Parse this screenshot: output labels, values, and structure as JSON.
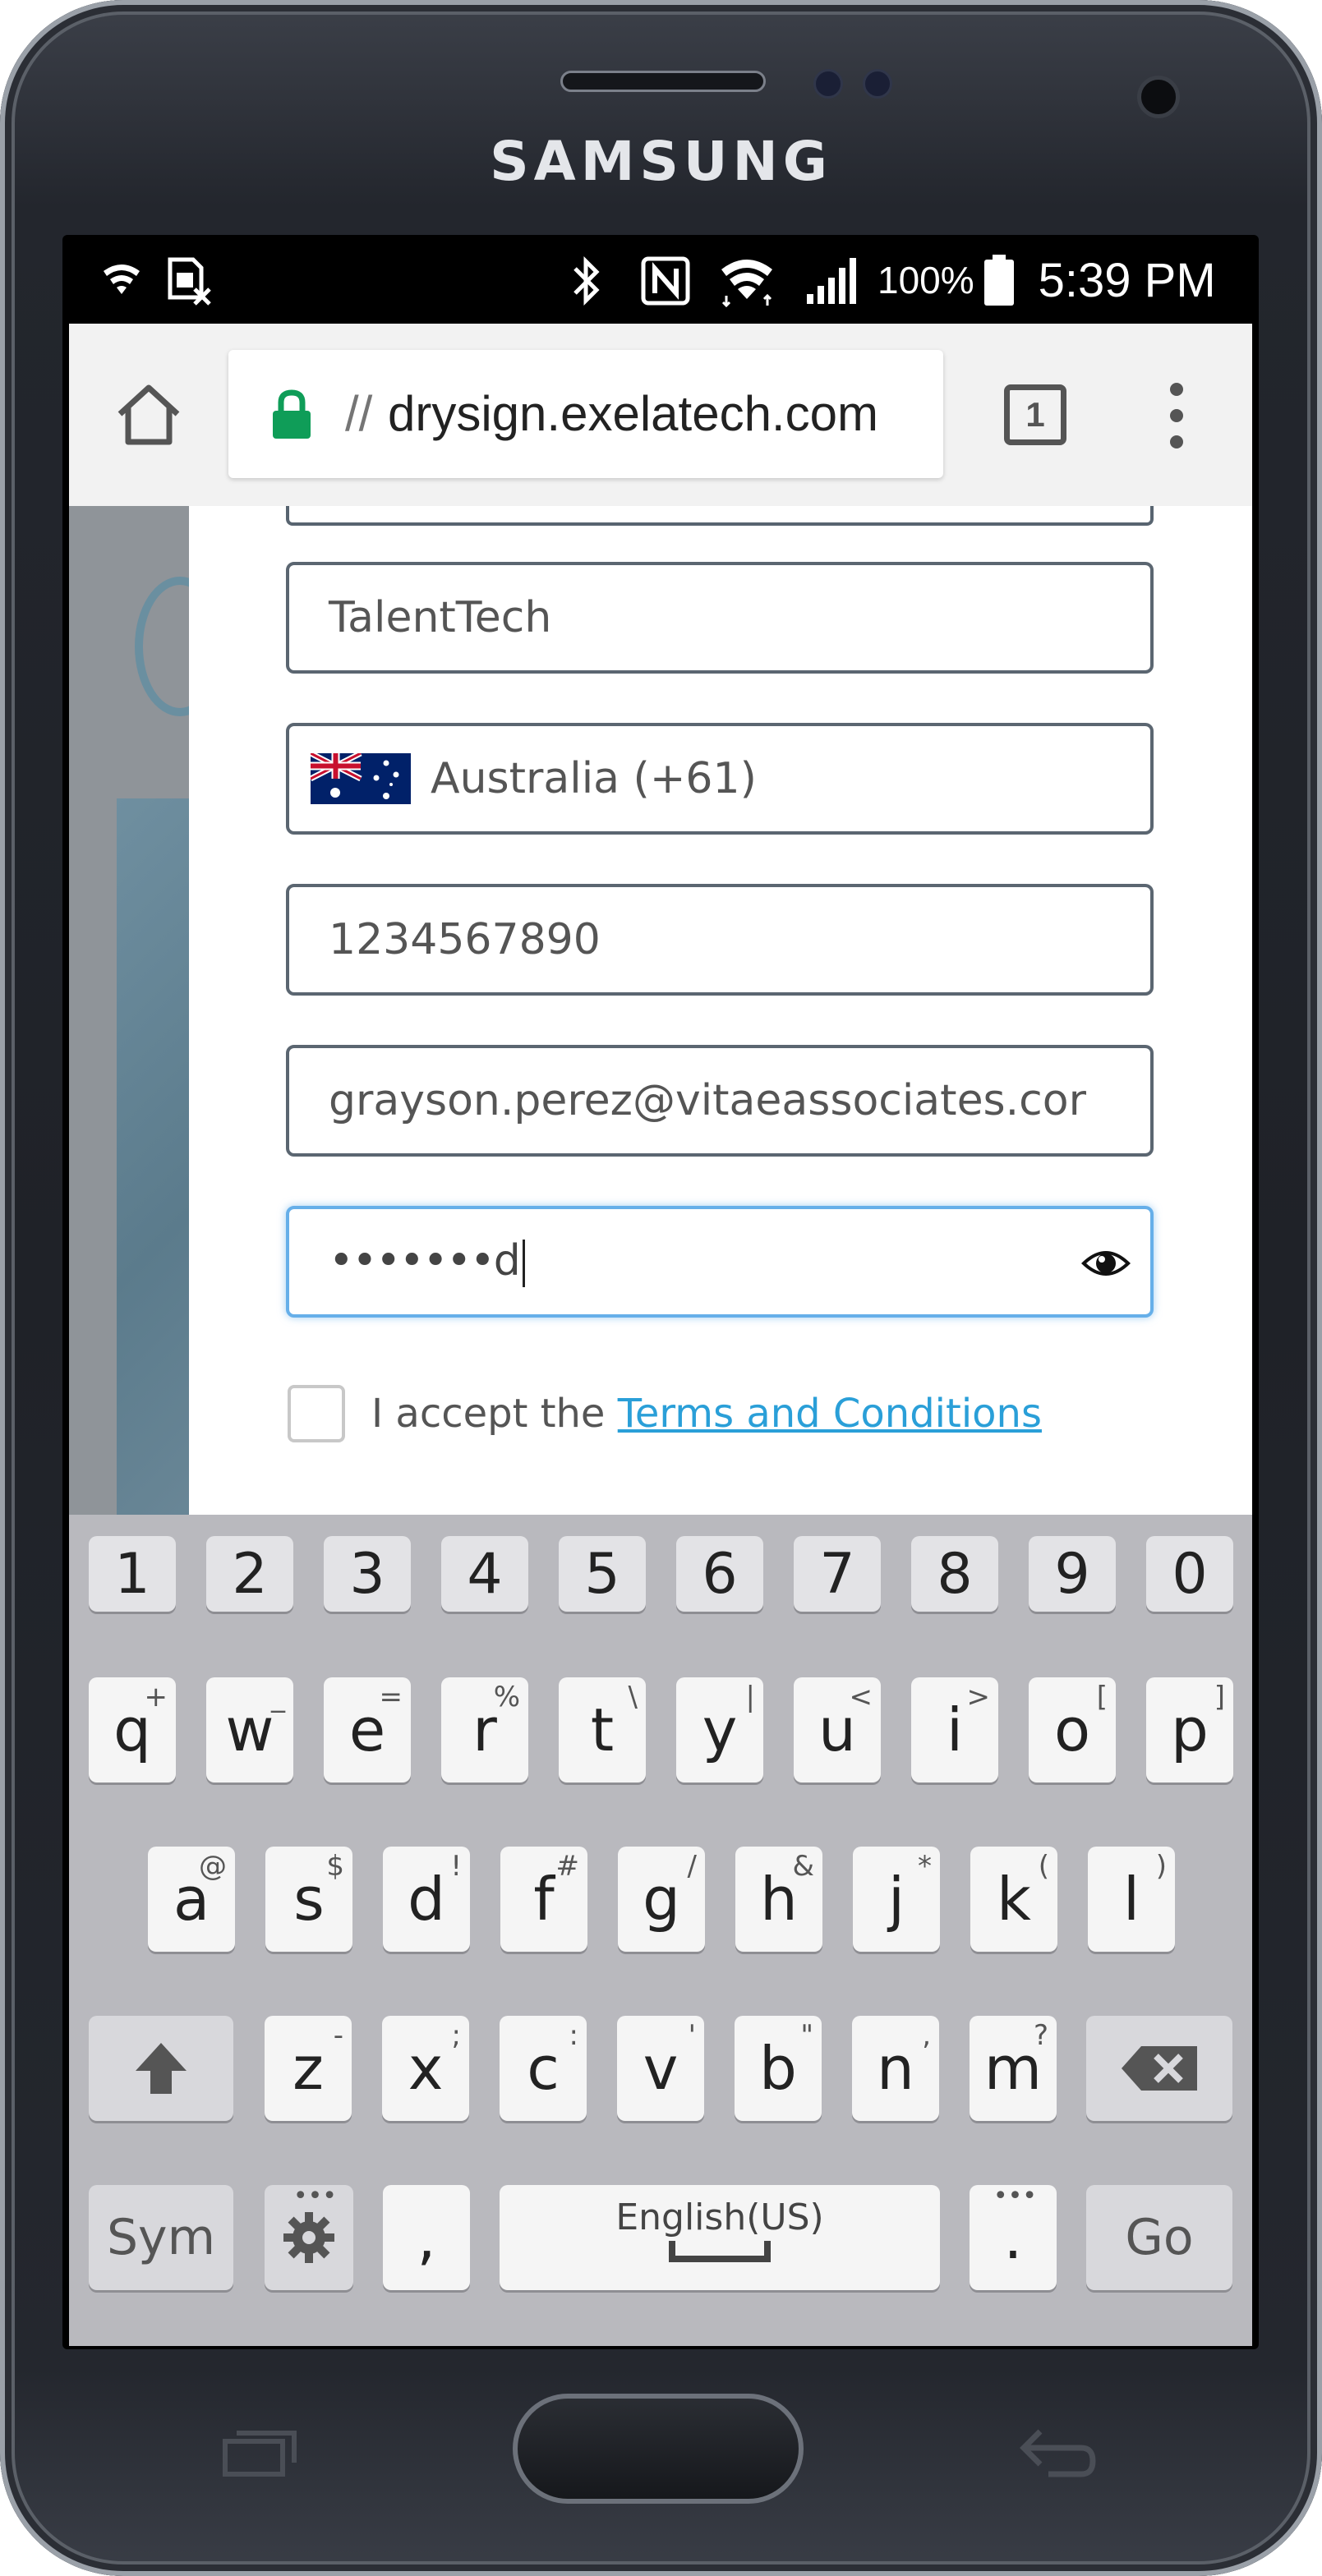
{
  "device": {
    "brand": "SAMSUNG"
  },
  "statusbar": {
    "battery": "100%",
    "time": "5:39 PM"
  },
  "browser": {
    "url_prefix": "//",
    "url": "drysign.exelatech.com",
    "tab_count": "1"
  },
  "form": {
    "company": "TalentTech",
    "country": "Australia (+61)",
    "phone": "1234567890",
    "email": "grayson.perez@vitaeassociates.cor",
    "password_masked": "•••••••",
    "password_last_char": "d",
    "terms_prefix": "I accept the ",
    "terms_link": "Terms and Conditions"
  },
  "keyboard": {
    "numbers": [
      "1",
      "2",
      "3",
      "4",
      "5",
      "6",
      "7",
      "8",
      "9",
      "0"
    ],
    "row1": [
      {
        "k": "q",
        "h": "+"
      },
      {
        "k": "w",
        "h": "_"
      },
      {
        "k": "e",
        "h": "="
      },
      {
        "k": "r",
        "h": "%"
      },
      {
        "k": "t",
        "h": "\\"
      },
      {
        "k": "y",
        "h": "|"
      },
      {
        "k": "u",
        "h": "<"
      },
      {
        "k": "i",
        "h": ">"
      },
      {
        "k": "o",
        "h": "["
      },
      {
        "k": "p",
        "h": "]"
      }
    ],
    "row2": [
      {
        "k": "a",
        "h": "@"
      },
      {
        "k": "s",
        "h": "$"
      },
      {
        "k": "d",
        "h": "!"
      },
      {
        "k": "f",
        "h": "#"
      },
      {
        "k": "g",
        "h": "/"
      },
      {
        "k": "h",
        "h": "&"
      },
      {
        "k": "j",
        "h": "*"
      },
      {
        "k": "k",
        "h": "("
      },
      {
        "k": "l",
        "h": ")"
      }
    ],
    "row3": [
      {
        "k": "z",
        "h": "-"
      },
      {
        "k": "x",
        "h": ";"
      },
      {
        "k": "c",
        "h": ":"
      },
      {
        "k": "v",
        "h": "'"
      },
      {
        "k": "b",
        "h": "\""
      },
      {
        "k": "n",
        "h": ","
      },
      {
        "k": "m",
        "h": "?"
      }
    ],
    "sym": "Sym",
    "comma": ",",
    "space_label": "English(US)",
    "period": ".",
    "go": "Go"
  },
  "colors": {
    "accent": "#2a9fd8",
    "focus": "#66afe9",
    "lock": "#0f9d58"
  }
}
